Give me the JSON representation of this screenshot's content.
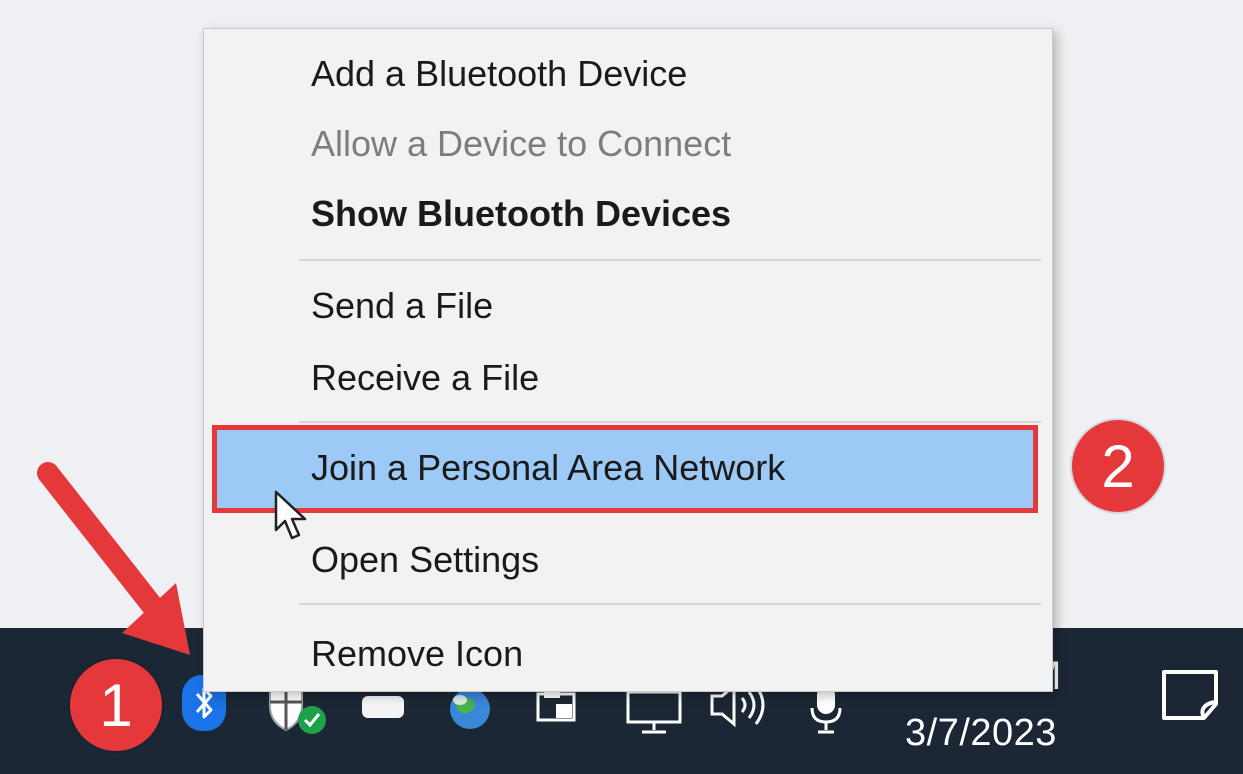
{
  "menu": {
    "items": [
      {
        "label": "Add a Bluetooth Device"
      },
      {
        "label": "Allow a Device to Connect"
      },
      {
        "label": "Show Bluetooth Devices"
      },
      {
        "label": "Send a File"
      },
      {
        "label": "Receive a File"
      },
      {
        "label": "Join a Personal Area Network"
      },
      {
        "label": "Open Settings"
      },
      {
        "label": "Remove Icon"
      }
    ],
    "highlight_color": "#9cc9f5",
    "highlight_border_color": "#e5383b"
  },
  "taskbar": {
    "time_fragment": "M",
    "date": "3/7/2023",
    "tray_icons": [
      "bluetooth-icon",
      "security-shield-icon",
      "onedrive-cloud-icon",
      "globe-icon",
      "usb-device-icon",
      "network-monitor-icon",
      "volume-icon",
      "microphone-icon"
    ],
    "background_color": "#1c2735"
  },
  "annotations": {
    "badge1": "1",
    "badge2": "2",
    "badge_color": "#e5383b"
  }
}
